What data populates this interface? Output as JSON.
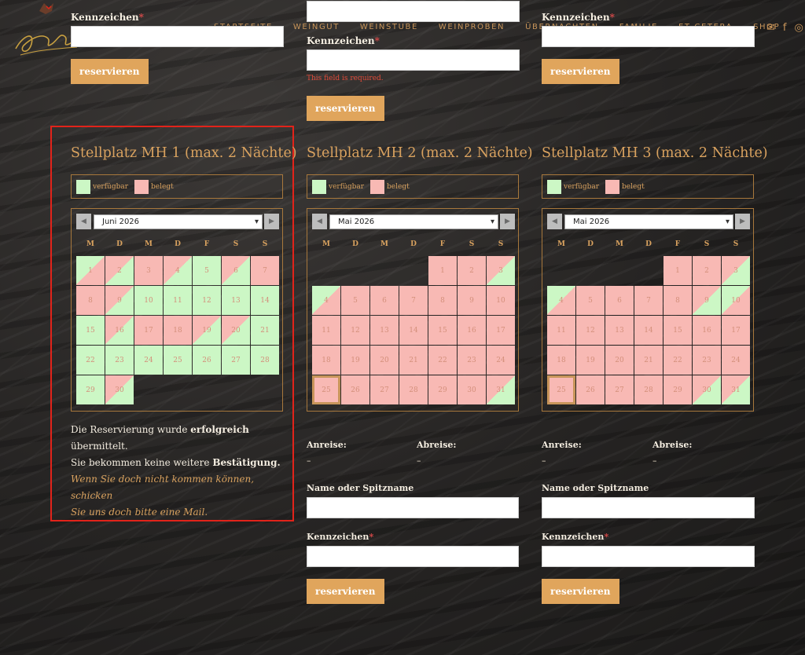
{
  "header": {
    "nav": [
      "STARTSEITE",
      "WEINGUT",
      "WEINSTUBE",
      "WEINPROBEN",
      "ÜBERNACHTEN",
      "FAMILIE",
      "ET CETERA",
      "SHOP"
    ],
    "icons": [
      "mail-icon",
      "facebook-icon",
      "instagram-icon"
    ]
  },
  "form": {
    "kennzeichen_label": "Kennzeichen",
    "required_mark": "*",
    "reserve_label": "reservieren",
    "field_required": "This field is required.",
    "anreise_label": "Anreise:",
    "abreise_label": "Abreise:",
    "dash": "–",
    "name_label": "Name oder Spitzname"
  },
  "legend": {
    "free": "verfügbar",
    "busy": "belegt"
  },
  "colors": {
    "free": "#ccf7c5",
    "busy": "#f8b9b4",
    "accent": "#d9a25f",
    "button": "#e0a55c",
    "highlight": "#e2231a"
  },
  "weekdays": [
    "M",
    "D",
    "M",
    "D",
    "F",
    "S",
    "S"
  ],
  "calendars": [
    {
      "title": "Stellplatz MH 1 (max. 2 Nächte)",
      "month": "Juni 2026",
      "offset": 0,
      "days": 30,
      "today": null,
      "states": [
        "arr",
        "dep",
        "busy",
        "dep",
        "free",
        "dep",
        "busy",
        "busy",
        "dep",
        "free",
        "free",
        "free",
        "free",
        "free",
        "free",
        "dep",
        "busy",
        "busy",
        "dep",
        "dep",
        "free",
        "free",
        "free",
        "free",
        "free",
        "free",
        "free",
        "free",
        "free",
        "dep"
      ]
    },
    {
      "title": "Stellplatz MH 2 (max. 2 Nächte)",
      "month": "Mai 2026",
      "offset": 4,
      "days": 31,
      "today": 25,
      "states": [
        "busy",
        "busy",
        "dep",
        "arr",
        "busy",
        "busy",
        "busy",
        "busy",
        "busy",
        "busy",
        "busy",
        "busy",
        "busy",
        "busy",
        "busy",
        "busy",
        "busy",
        "busy",
        "busy",
        "busy",
        "busy",
        "busy",
        "busy",
        "busy",
        "busy",
        "busy",
        "busy",
        "busy",
        "busy",
        "busy",
        "dep"
      ]
    },
    {
      "title": "Stellplatz MH 3 (max. 2 Nächte)",
      "month": "Mai 2026",
      "offset": 4,
      "days": 31,
      "today": 25,
      "states": [
        "busy",
        "busy",
        "dep",
        "arr",
        "busy",
        "busy",
        "busy",
        "busy",
        "dep",
        "arr",
        "busy",
        "busy",
        "busy",
        "busy",
        "busy",
        "busy",
        "busy",
        "busy",
        "busy",
        "busy",
        "busy",
        "busy",
        "busy",
        "busy",
        "busy",
        "busy",
        "busy",
        "busy",
        "busy",
        "dep",
        "dep"
      ]
    }
  ],
  "confirmation": {
    "line1_pre": "Die Reservierung wurde ",
    "line1_bold": "erfolgreich",
    "line2": "übermittelt.",
    "line3_pre": "Sie bekommen keine weitere ",
    "line3_bold": "Bestätigung.",
    "line4": "Wenn Sie doch nicht kommen können, schicken",
    "line5": "Sie uns doch bitte eine Mail."
  }
}
